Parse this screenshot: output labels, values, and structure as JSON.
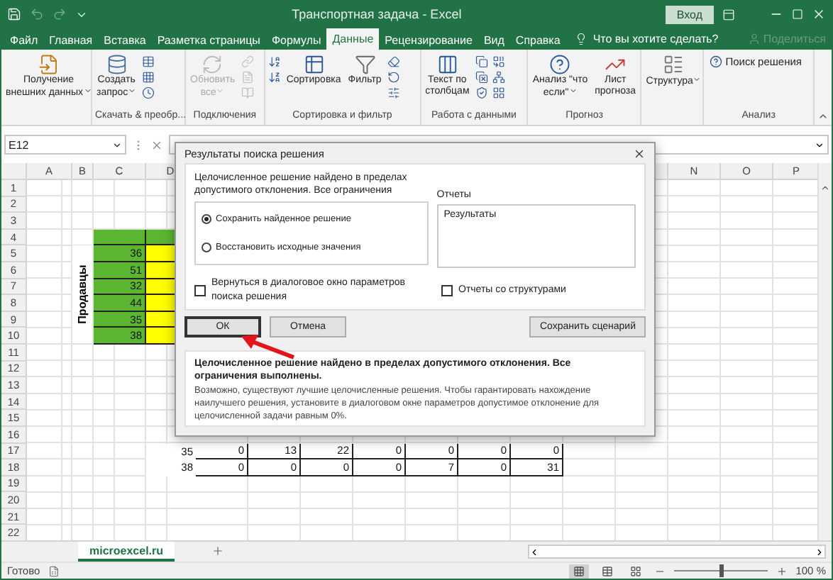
{
  "title_bar": {
    "title": "Транспортная задача  -  Excel",
    "signin": "Вход"
  },
  "tabs": [
    {
      "label": "Файл",
      "selected": false
    },
    {
      "label": "Главная",
      "selected": false
    },
    {
      "label": "Вставка",
      "selected": false
    },
    {
      "label": "Разметка страницы",
      "selected": false
    },
    {
      "label": "Формулы",
      "selected": false
    },
    {
      "label": "Данные",
      "selected": true
    },
    {
      "label": "Рецензирование",
      "selected": false
    },
    {
      "label": "Вид",
      "selected": false
    },
    {
      "label": "Справка",
      "selected": false
    }
  ],
  "tell_me": "Что вы хотите сделать?",
  "share": "Поделиться",
  "ribbon_groups": [
    {
      "items": [
        {
          "kind": "large",
          "label": "Получение\nвнешних данных",
          "caret": true,
          "disabled": false
        }
      ]
    },
    {
      "label": "Скачать & преобр...",
      "items": [
        {
          "kind": "large",
          "label": "Создать\nзапрос",
          "caret": true,
          "disabled": false
        },
        {
          "kind": "icons",
          "disabled": false
        }
      ]
    },
    {
      "label": "Подключения",
      "items": [
        {
          "kind": "large",
          "label": "Обновить\nвсе",
          "caret": true,
          "disabled": true
        },
        {
          "kind": "icons",
          "disabled": true
        }
      ]
    },
    {
      "label": "Сортировка и фильтр",
      "items": [
        {
          "kind": "icons",
          "disabled": false
        },
        {
          "kind": "large",
          "label": "Сортировка",
          "caret": false,
          "disabled": false
        },
        {
          "kind": "large",
          "label": "Фильтр",
          "caret": false,
          "disabled": false
        },
        {
          "kind": "icons",
          "disabled": false
        }
      ]
    },
    {
      "label": "Работа с данными",
      "items": [
        {
          "kind": "large",
          "label": "Текст по\nстолбцам",
          "caret": false,
          "disabled": false
        },
        {
          "kind": "icons",
          "disabled": false
        }
      ]
    },
    {
      "label": "Прогноз",
      "items": [
        {
          "kind": "large",
          "label": "Анализ \"что\nесли\"",
          "caret": true,
          "disabled": false
        },
        {
          "kind": "large",
          "label": "Лист\nпрогноза",
          "caret": false,
          "disabled": false
        }
      ]
    },
    {
      "items": [
        {
          "kind": "large",
          "label": "Структура",
          "caret": true,
          "disabled": false
        }
      ]
    },
    {
      "label": "Анализ",
      "items": [
        {
          "kind": "small",
          "label": "Поиск решения",
          "caret": false,
          "disabled": false
        }
      ]
    }
  ],
  "name_box": "E12",
  "column_headers_left": [
    "A",
    "B",
    "C",
    "D"
  ],
  "column_headers_right": [
    "N",
    "O",
    "P"
  ],
  "row_headers": [
    "1",
    "2",
    "3",
    "4",
    "5",
    "6",
    "7",
    "8",
    "9",
    "10",
    "11",
    "12",
    "13",
    "14",
    "15",
    "16",
    "17",
    "18",
    "19",
    "20",
    "21",
    "22"
  ],
  "sales": {
    "label": "Продавцы",
    "values": [
      "36",
      "51",
      "32",
      "44",
      "35",
      "38"
    ]
  },
  "result_rows": [
    {
      "cells": [
        "35",
        "0",
        "13",
        "22",
        "0",
        "0",
        "0",
        "0"
      ]
    },
    {
      "cells": [
        "38",
        "0",
        "0",
        "0",
        "0",
        "7",
        "0",
        "31"
      ]
    }
  ],
  "dialog": {
    "title": "Результаты поиска решения",
    "message": "Целочисленное решение найдено в пределах допустимого отклонения. Все ограничения",
    "options": [
      {
        "label": "Сохранить найденное решение",
        "selected": true
      },
      {
        "label": "Восстановить исходные значения",
        "selected": false
      }
    ],
    "reports_label": "Отчеты",
    "reports": [
      "Результаты"
    ],
    "return_checkbox": {
      "label": "Вернуться в диалоговое окно параметров поиска решения",
      "checked": false
    },
    "outline_checkbox": {
      "label": "Отчеты со структурами",
      "checked": false
    },
    "buttons": [
      {
        "label": "ОК",
        "default": true
      },
      {
        "label": "Отмена",
        "default": false
      }
    ],
    "save_button": "Сохранить сценарий",
    "summary_title": "Целочисленное решение найдено в пределах допустимого отклонения. Все ограничения выполнены.",
    "summary_text": "Возможно, существуют лучшие целочисленные решения. Чтобы гарантировать нахождение наилучшего решения, установите в диалоговом окне параметров допустимое отклонение для целочисленной задачи равным 0%."
  },
  "sheet_tabs": [
    {
      "label": "microexcel.ru",
      "selected": true
    }
  ],
  "status": {
    "text": "Готово",
    "views": [
      {
        "selected": true
      },
      {
        "selected": false
      },
      {
        "selected": false
      }
    ],
    "zoom_slider": {
      "level": 0.5
    },
    "zoom": "100 %"
  }
}
